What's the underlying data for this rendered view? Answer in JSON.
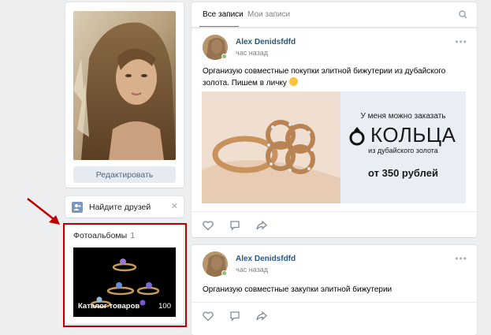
{
  "profile": {
    "edit_label": "Редактировать"
  },
  "friends": {
    "label": "Найдите друзей",
    "close": "✕"
  },
  "albums": {
    "title": "Фотоальбомы",
    "count": "1",
    "album_name": "Каталог товаров",
    "album_count": "100"
  },
  "feed": {
    "tab_all": "Все записи",
    "tab_mine": "Мои записи"
  },
  "posts": [
    {
      "author": "Alex Denidsfdfd",
      "time": "час назад",
      "text": "Организую совместные покупки элитной бижутерии из дубайского золота. Пишем в личку",
      "ad": {
        "line1": "У меня можно заказать",
        "line2": "КОЛЬЦА",
        "line3": "из дубайского золота",
        "line4": "от 350 рублей"
      }
    },
    {
      "author": "Alex Denidsfdfd",
      "time": "час назад",
      "text": "Организую совместные закупки элитной бижутерии"
    }
  ],
  "colors": {
    "link": "#2a5885",
    "accent": "#5181b8",
    "highlight": "#c00000",
    "online": "#8ac176"
  },
  "icons": [
    "close-icon",
    "search-icon",
    "more-icon",
    "like-icon",
    "comment-icon",
    "share-icon",
    "ring-icon",
    "add-friend-icon",
    "arrow-icon"
  ]
}
